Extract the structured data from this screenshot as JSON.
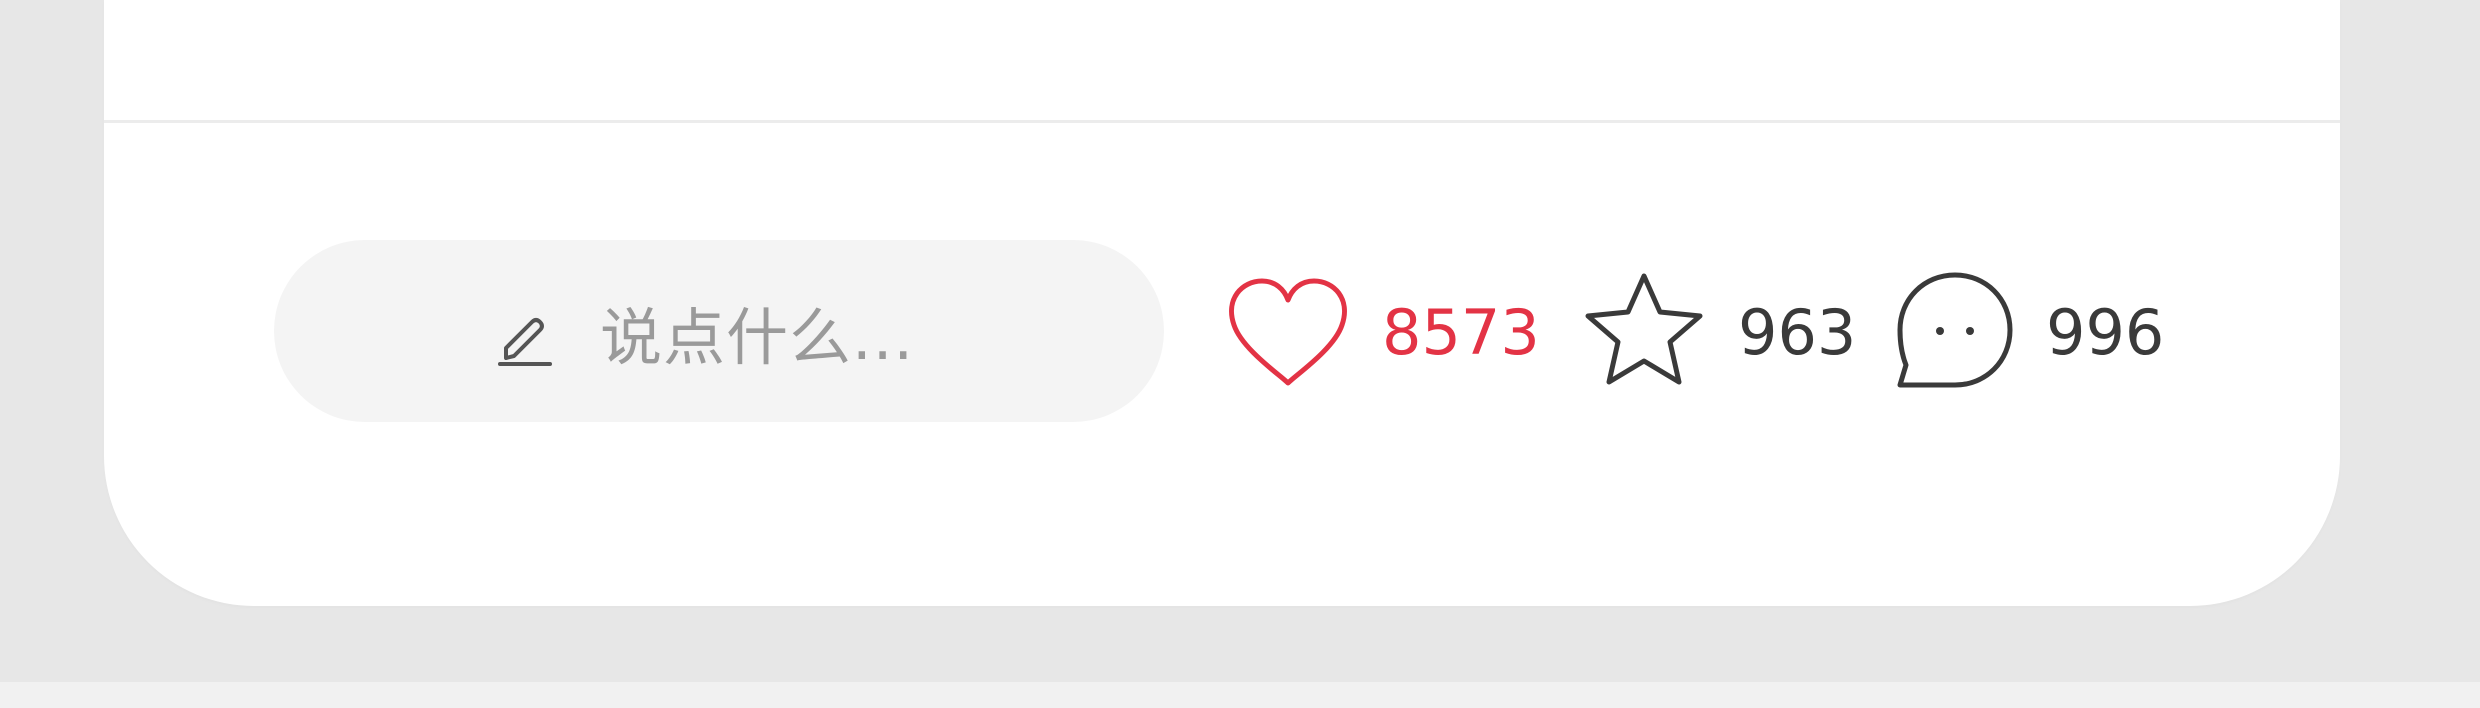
{
  "bottom_bar": {
    "comment_input": {
      "placeholder": "说点什么...",
      "icon": "pencil-icon"
    },
    "metrics": {
      "likes": {
        "count": "8573",
        "icon": "heart-icon",
        "color": "#e33345"
      },
      "favorites": {
        "count": "963",
        "icon": "star-icon",
        "color": "#3a3a3a"
      },
      "comments": {
        "count": "996",
        "icon": "comment-bubble-icon",
        "color": "#3a3a3a"
      }
    }
  }
}
